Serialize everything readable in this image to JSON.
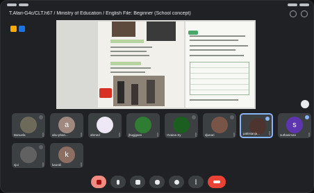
{
  "meeting": {
    "title": "T.Afari-G4c/CLT.h67 / Ministry of Education / English File: Beginner (School concept)"
  },
  "participants": [
    {
      "name": "Banuela",
      "avatar_letter": "",
      "avatar_color": "#6d6a5a"
    },
    {
      "name": "abu-phan...",
      "avatar_letter": "a",
      "avatar_color": "#a1887f"
    },
    {
      "name": "ahmed",
      "avatar_letter": "",
      "avatar_color": "#ede7f6"
    },
    {
      "name": "jhugjgans",
      "avatar_letter": "",
      "avatar_color": "#2e7d32"
    },
    {
      "name": "Ovaisa Sy",
      "avatar_letter": "",
      "avatar_color": "#1b5e20"
    },
    {
      "name": "djunari",
      "avatar_letter": "",
      "avatar_color": "#795548"
    },
    {
      "name": "pakistanja...",
      "avatar_letter": "",
      "avatar_color": "#4e342e"
    },
    {
      "name": "suthasiman",
      "avatar_letter": "s",
      "avatar_color": "#5e35b1"
    },
    {
      "name": "sjui",
      "avatar_letter": "",
      "avatar_color": "#616161"
    },
    {
      "name": "kaurali",
      "avatar_letter": "k",
      "avatar_color": "#8d6e63"
    }
  ],
  "colors": {
    "accent": "#8ab4f8",
    "hangup": "#ea4335",
    "background": "#202124"
  }
}
